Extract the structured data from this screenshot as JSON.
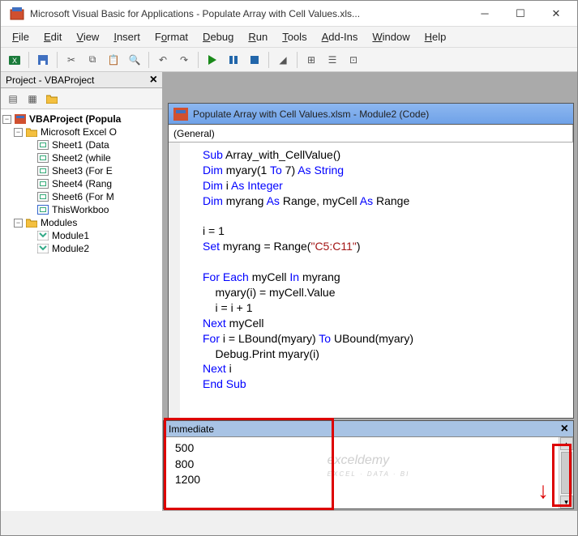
{
  "window": {
    "title": "Microsoft Visual Basic for Applications - Populate Array with Cell Values.xls..."
  },
  "menus": {
    "file": "File",
    "edit": "Edit",
    "view": "View",
    "insert": "Insert",
    "format": "Format",
    "debug": "Debug",
    "run": "Run",
    "tools": "Tools",
    "addins": "Add-Ins",
    "window": "Window",
    "help": "Help"
  },
  "project_panel": {
    "title": "Project - VBAProject",
    "root": "VBAProject (Popula",
    "excel_objects": "Microsoft Excel O",
    "sheets": [
      "Sheet1 (Data",
      "Sheet2 (while",
      "Sheet3 (For E",
      "Sheet4 (Rang",
      "Sheet6 (For M",
      "ThisWorkboo"
    ],
    "modules_folder": "Modules",
    "modules": [
      "Module1",
      "Module2"
    ]
  },
  "code_window": {
    "title": "Populate Array with Cell Values.xlsm - Module2 (Code)",
    "dropdown_left": "(General)"
  },
  "code": {
    "l1a": "Sub",
    "l1b": " Array_with_CellValue()",
    "l2a": "Dim",
    "l2b": " myary(1 ",
    "l2c": "To",
    "l2d": " 7) ",
    "l2e": "As String",
    "l3a": "Dim",
    "l3b": " i ",
    "l3c": "As Integer",
    "l4a": "Dim",
    "l4b": " myrang ",
    "l4c": "As",
    "l4d": " Range, myCell ",
    "l4e": "As",
    "l4f": " Range",
    "l6": "i = 1",
    "l7a": "Set",
    "l7b": " myrang = Range(",
    "l7c": "\"C5:C11\"",
    "l7d": ")",
    "l9a": "For Each",
    "l9b": " myCell ",
    "l9c": "In",
    "l9d": " myrang",
    "l10": "    myary(i) = myCell.Value",
    "l11": "    i = i + 1",
    "l12a": "Next",
    "l12b": " myCell",
    "l13a": "For",
    "l13b": " i = LBound(myary) ",
    "l13c": "To",
    "l13d": " UBound(myary)",
    "l14": "    Debug.Print myary(i)",
    "l15a": "Next",
    "l15b": " i",
    "l16": "End Sub"
  },
  "immediate": {
    "title": "Immediate",
    "lines": [
      " 500",
      " 800",
      " 1200"
    ]
  },
  "watermark": {
    "name": "exceldemy",
    "tag": "EXCEL · DATA · BI"
  }
}
